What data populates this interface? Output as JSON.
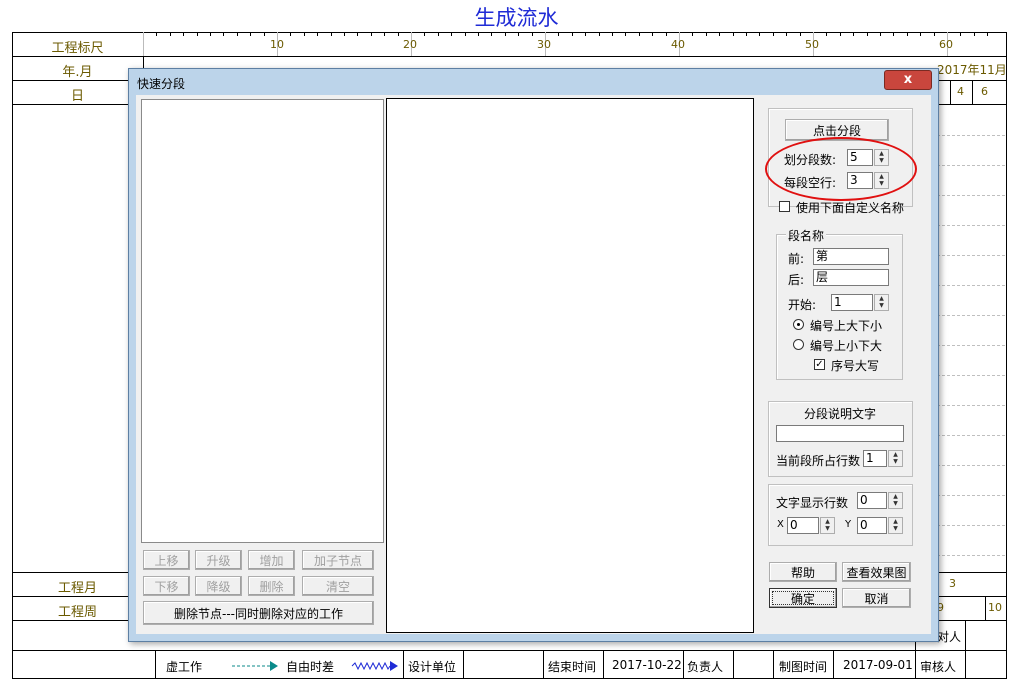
{
  "page_title": "生成流水",
  "background": {
    "row_labels": {
      "ruler": "工程标尺",
      "year_month": "年.月",
      "day": "日",
      "project_month": "工程月",
      "project_week": "工程周"
    },
    "ruler_ticks": [
      "10",
      "20",
      "30",
      "40",
      "50",
      "60"
    ],
    "months_visible": [
      "2017年11月"
    ],
    "days_visible": [
      "4",
      "6"
    ],
    "project_month_value": "3",
    "project_week_values": [
      "9",
      "10"
    ],
    "footer": {
      "virtual_work": "虚工作",
      "free_float": "自由时差",
      "design_unit": "设计单位",
      "end_time_label": "结束时间",
      "end_time_value": "2017-10-22",
      "person_in_charge": "负责人",
      "drawing_time_label": "制图时间",
      "drawing_time_value": "2017-09-01",
      "reviewer": "审核人",
      "partial_above": "对人"
    },
    "line_colors": {
      "arrow": "#0a8a8a",
      "wave": "#1f2bd6"
    }
  },
  "dialog": {
    "title": "快速分段",
    "close_label": "x",
    "tree_buttons": {
      "move_up": "上移",
      "promote": "升级",
      "add": "增加",
      "add_child": "加子节点",
      "move_down": "下移",
      "demote": "降级",
      "delete": "删除",
      "clear": "清空",
      "delete_node": "删除节点---同时删除对应的工作"
    },
    "segment": {
      "click_segment": "点击分段",
      "count_label": "划分段数:",
      "count_value": "5",
      "blank_rows_label": "每段空行:",
      "blank_rows_value": "3",
      "use_custom_name": "使用下面自定义名称"
    },
    "name_group": {
      "title": "段名称",
      "prefix_label": "前:",
      "prefix_value": "第",
      "suffix_label": "后:",
      "suffix_value": "层",
      "start_label": "开始:",
      "start_value": "1",
      "radio_big_small": "编号上大下小",
      "radio_small_big": "编号上小下大",
      "uppercase": "序号大写"
    },
    "desc_group": {
      "title": "分段说明文字",
      "desc_value": "",
      "rows_label": "当前段所占行数",
      "rows_value": "1"
    },
    "text_group": {
      "rows_label": "文字显示行数",
      "rows_value": "0",
      "x_label": "X",
      "x_value": "0",
      "y_label": "Y",
      "y_value": "0"
    },
    "buttons": {
      "help": "帮助",
      "preview": "查看效果图",
      "ok": "确定",
      "cancel": "取消"
    },
    "annotation_color": "#e01010"
  }
}
